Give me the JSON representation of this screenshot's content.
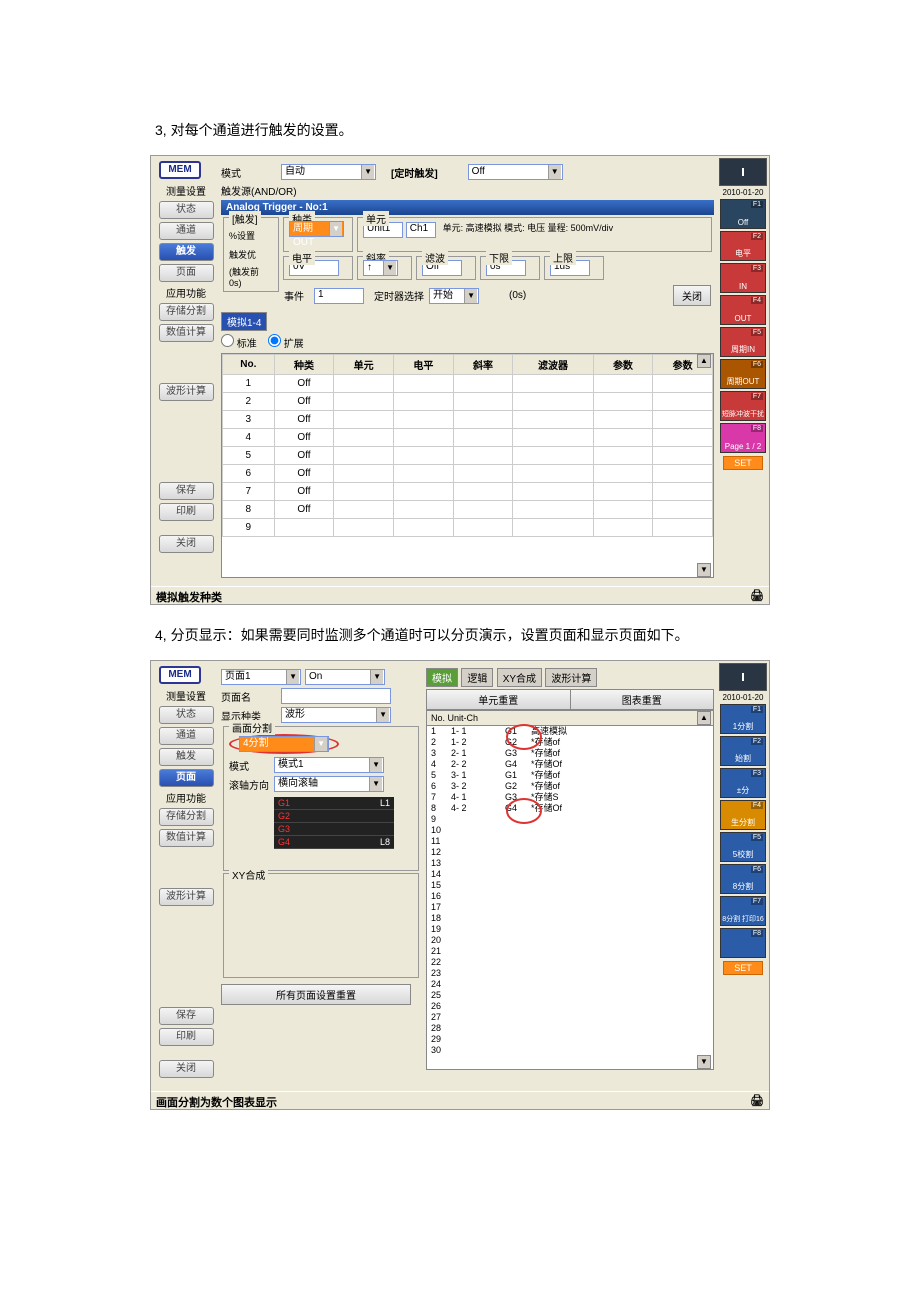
{
  "text": {
    "step3": "3, 对每个通道进行触发的设置。",
    "step4": "4, 分页显示：如果需要同时监测多个通道时可以分页演示，设置页面和显示页面如下。"
  },
  "s1": {
    "mem": "MEM",
    "date": "2010-01-20",
    "leftTitle1": "测量设置",
    "leftTitle2": "应用功能",
    "leftButtons": [
      "状态",
      "通道",
      "触发",
      "页面",
      "存储分割",
      "数值计算",
      "波形计算",
      "保存",
      "印刷",
      "关闭"
    ],
    "mode": "模式",
    "modeVal": "自动",
    "timedTrigger": "[定时触发]",
    "timedVal": "Off",
    "trigSrc": "触发源(AND/OR)",
    "analogTitle": "Analog Trigger - No:1",
    "trigGroup": "[触发]",
    "pctSet": "%设置",
    "trigPri": "触发优",
    "prePost": "(触发前 0s)",
    "kind": "种类",
    "kindVal": "周期OUT",
    "unit": "单元",
    "unitVal": "Unit1",
    "chVal": "Ch1",
    "unitInfo": "单元: 高速模拟  模式: 电压  量程: 500mV/div",
    "level": "电平",
    "levelVal": "0V",
    "slope": "斜率",
    "slopeVal": "↑",
    "filter": "滤波",
    "filterVal": "Off",
    "lower": "下限",
    "lowerVal": "0s",
    "upper": "上限",
    "upperVal": "1us",
    "event": "事件",
    "eventVal": "1",
    "timerSel": "定时器选择",
    "timerVal": "开始",
    "zeroS": "(0s)",
    "close": "关闭",
    "tabAnalog": "模拟1-4",
    "standard": "标准",
    "expand": "扩展",
    "headers": [
      "No.",
      "种类",
      "单元",
      "电平",
      "斜率",
      "滤波器",
      "参数",
      "参数"
    ],
    "rows": [
      {
        "no": "1",
        "kind": "Off"
      },
      {
        "no": "2",
        "kind": "Off"
      },
      {
        "no": "3",
        "kind": "Off"
      },
      {
        "no": "4",
        "kind": "Off"
      },
      {
        "no": "5",
        "kind": "Off"
      },
      {
        "no": "6",
        "kind": "Off"
      },
      {
        "no": "7",
        "kind": "Off"
      },
      {
        "no": "8",
        "kind": "Off"
      },
      {
        "no": "9",
        "kind": ""
      }
    ],
    "status": "模拟触发种类",
    "fkeys": [
      {
        "bg": "#2a4560",
        "txt": "Off",
        "lbl": "F1"
      },
      {
        "bg": "#c83a3a",
        "txt": "电平",
        "lbl": "F2"
      },
      {
        "bg": "#c83a3a",
        "txt": "IN",
        "lbl": "F3"
      },
      {
        "bg": "#c83a3a",
        "txt": "OUT",
        "lbl": "F4"
      },
      {
        "bg": "#c83a3a",
        "txt": "周期IN",
        "lbl": "F5"
      },
      {
        "bg": "#aa5500",
        "txt": "周期OUT",
        "lbl": "F6"
      },
      {
        "bg": "#c83a3a",
        "txt": "短脉冲波干扰",
        "lbl": "F7"
      },
      {
        "bg": "#d838a8",
        "txt": "Page 1 / 2",
        "lbl": "F8"
      }
    ],
    "set": "SET"
  },
  "s2": {
    "mem": "MEM",
    "date": "2010-01-20",
    "leftTitle1": "测量设置",
    "leftTitle2": "应用功能",
    "leftButtons": [
      "状态",
      "通道",
      "触发",
      "页面",
      "存储分割",
      "数值计算",
      "波形计算",
      "保存",
      "印刷",
      "关闭"
    ],
    "page": "页面1",
    "on": "On",
    "pageName": "页面名",
    "dispKind": "显示种类",
    "dispKindVal": "波形",
    "screenSplit": "画面分割",
    "screenSplitVal": "4分割",
    "modeLbl": "模式",
    "modeVal": "模式1",
    "scrollDir": "滚轴方向",
    "scrollVal": "横向滚轴",
    "xy": "XY合成",
    "allReset": "所有页面设置重置",
    "tabs": [
      "模拟",
      "逻辑",
      "XY合成",
      "波形计算"
    ],
    "unitReset": "单元重置",
    "chartReset": "图表重置",
    "listHeader": "No. Unit-Ch",
    "listRows": [
      {
        "n": "1",
        "u": "1- 1",
        "g": "G1",
        "t": "高速模拟"
      },
      {
        "n": "2",
        "u": "1- 2",
        "g": "G2",
        "t": "*存储of"
      },
      {
        "n": "3",
        "u": "2- 1",
        "g": "G3",
        "t": "*存储of"
      },
      {
        "n": "4",
        "u": "2- 2",
        "g": "G4",
        "t": "*存储Of"
      },
      {
        "n": "5",
        "u": "3- 1",
        "g": "G1",
        "t": "*存储of"
      },
      {
        "n": "6",
        "u": "3- 2",
        "g": "G2",
        "t": "*存储of"
      },
      {
        "n": "7",
        "u": "4- 1",
        "g": "G3",
        "t": "*存储S"
      },
      {
        "n": "8",
        "u": "4- 2",
        "g": "G4",
        "t": "*存储Of"
      }
    ],
    "numbers": [
      "9",
      "10",
      "11",
      "12",
      "13",
      "14",
      "15",
      "16",
      "17",
      "18",
      "19",
      "20",
      "21",
      "22",
      "23",
      "24",
      "25",
      "26",
      "27",
      "28",
      "29",
      "30"
    ],
    "darkItems": [
      "G1",
      "G2",
      "G3",
      "G4"
    ],
    "L1": "L1",
    "L8": "L8",
    "status": "画面分割为数个图表显示",
    "fkeys": [
      {
        "bg": "#2a5ca8",
        "txt": "1分割",
        "lbl": "F1"
      },
      {
        "bg": "#2a5ca8",
        "txt": "始割",
        "lbl": "F2"
      },
      {
        "bg": "#2a5ca8",
        "txt": "±分",
        "lbl": "F3"
      },
      {
        "bg": "#d88a00",
        "txt": "生分割",
        "lbl": "F4"
      },
      {
        "bg": "#2a5ca8",
        "txt": "5校割",
        "lbl": "F5"
      },
      {
        "bg": "#2a5ca8",
        "txt": "8分割",
        "lbl": "F6"
      },
      {
        "bg": "#2a5ca8",
        "txt": "8分割 打印16",
        "lbl": "F7"
      },
      {
        "bg": "#2a5ca8",
        "txt": "",
        "lbl": "F8"
      }
    ],
    "set": "SET"
  }
}
